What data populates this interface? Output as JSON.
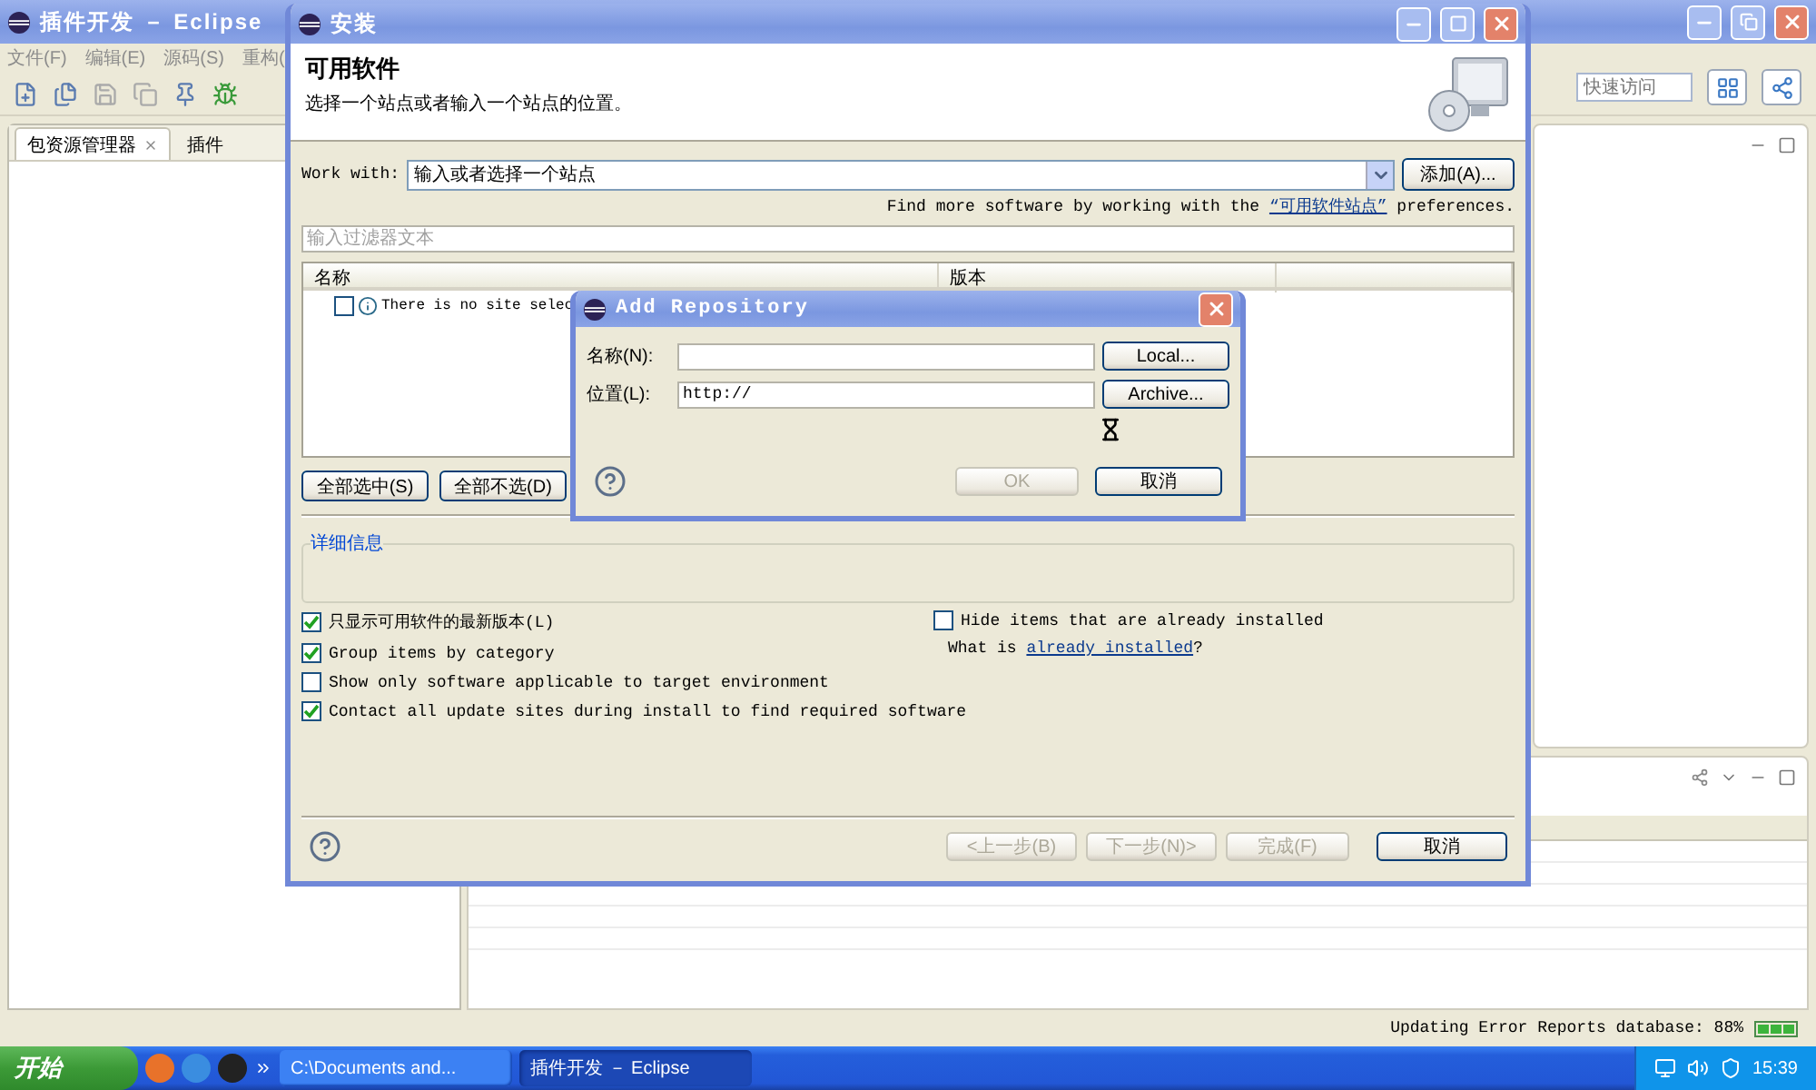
{
  "main_window": {
    "title": "插件开发 － Eclipse",
    "menu": [
      "文件(F)",
      "编辑(E)",
      "源码(S)",
      "重构("
    ],
    "quick_access": {
      "placeholder": "快速访问"
    },
    "views": [
      {
        "label": "包资源管理器",
        "selected": true
      },
      {
        "label": "插件",
        "selected": false
      }
    ],
    "status": "Updating Error Reports database: 88%"
  },
  "install_dialog": {
    "title": "安装",
    "heading": "可用软件",
    "description": "选择一个站点或者输入一个站点的位置。",
    "work_with": {
      "label": "Work with:",
      "value": "输入或者选择一个站点"
    },
    "add_button": "添加(A)...",
    "hint": {
      "before": "Find more software by working with the ",
      "link": "“可用软件站点”",
      "after": " preferences."
    },
    "filter": {
      "placeholder": "输入过滤器文本"
    },
    "table": {
      "columns": [
        "名称",
        "版本"
      ],
      "rows": [
        {
          "checked": false,
          "text": "There is no site selec"
        }
      ]
    },
    "select_buttons": [
      "全部选中(S)",
      "全部不选(D)"
    ],
    "details": {
      "title": "详细信息"
    },
    "options": [
      {
        "label": "只显示可用软件的最新版本(L)",
        "checked": true
      },
      {
        "label": "Group items by category",
        "checked": true
      },
      {
        "label": "Show only software applicable to target environment",
        "checked": false
      },
      {
        "label": "Contact all update sites during install to find required software",
        "checked": true
      }
    ],
    "installed": {
      "checkbox": {
        "label": "Hide items that are already installed",
        "checked": false
      },
      "question": {
        "before": "What is ",
        "link": "already installed",
        "after": "?"
      }
    },
    "buttons": [
      {
        "label": "<上一步(B)",
        "disabled": true
      },
      {
        "label": "下一步(N)>",
        "disabled": true
      },
      {
        "label": "完成(F)",
        "disabled": true
      },
      {
        "label": "取消",
        "disabled": false
      }
    ]
  },
  "add_repository_dialog": {
    "title": "Add Repository",
    "fields": [
      {
        "label": "名称(N):",
        "button": "Local..."
      },
      {
        "label": "位置(L):",
        "value": "http://",
        "button": "Archive..."
      }
    ],
    "buttons": [
      {
        "label": "OK",
        "disabled": true
      },
      {
        "label": "取消",
        "disabled": false
      }
    ]
  },
  "taskbar": {
    "start": "开始",
    "tasks": [
      {
        "label": "C:\\Documents and...",
        "selected": false
      },
      {
        "label": "插件开发 － Eclipse",
        "selected": true
      }
    ],
    "clock": "15:39"
  }
}
